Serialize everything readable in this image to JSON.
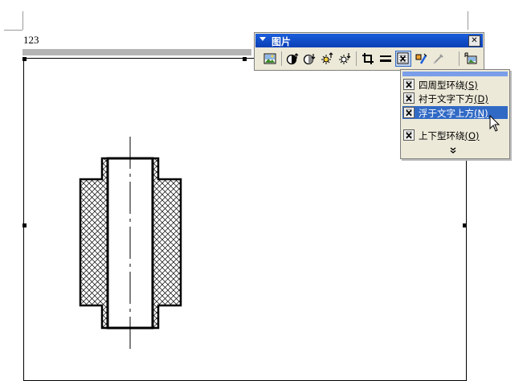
{
  "document": {
    "page_text": "123"
  },
  "toolbar": {
    "title": "图片",
    "close_label": "✕",
    "buttons": [
      {
        "name": "insert-picture-button",
        "icon": "picture-icon"
      },
      {
        "name": "more-contrast-button",
        "icon": "contrast-up-icon"
      },
      {
        "name": "less-contrast-button",
        "icon": "contrast-down-icon"
      },
      {
        "name": "more-brightness-button",
        "icon": "brightness-up-icon"
      },
      {
        "name": "less-brightness-button",
        "icon": "brightness-down-icon"
      },
      {
        "name": "crop-button",
        "icon": "crop-icon"
      },
      {
        "name": "line-style-button",
        "icon": "line-style-icon"
      },
      {
        "name": "text-wrapping-button",
        "icon": "text-wrap-icon"
      },
      {
        "name": "format-picture-button",
        "icon": "format-picture-icon"
      },
      {
        "name": "set-transparent-color-button",
        "icon": "transparent-color-icon"
      },
      {
        "name": "reset-picture-button",
        "icon": "reset-picture-icon"
      }
    ]
  },
  "wrap_menu": {
    "items": [
      {
        "label": "四周型环绕",
        "accel": "S",
        "highlighted": false
      },
      {
        "label": "衬于文字下方",
        "accel": "D",
        "highlighted": false
      },
      {
        "label": "浮于文字上方",
        "accel": "N",
        "highlighted": true
      },
      {
        "label": "上下型环绕",
        "accel": "O",
        "highlighted": false
      }
    ],
    "more_label": "»",
    "colors": {
      "highlight": "#316ac5",
      "title_bar": "#0a3fb6",
      "face": "#ece9d8"
    }
  }
}
